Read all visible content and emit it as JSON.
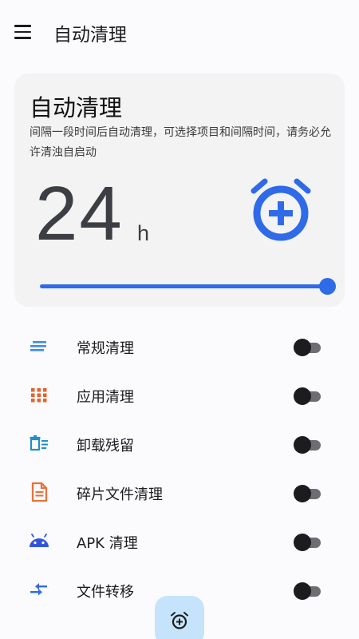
{
  "appbar": {
    "title": "自动清理",
    "menu_icon": "menu-icon"
  },
  "card": {
    "title": "自动清理",
    "description": "间隔一段时间后自动清理，可选择项目和间隔时间，请务必允许清浊自启动",
    "hours_value": "24",
    "hours_unit": "h",
    "alarm_icon": "alarm-add-icon",
    "slider_fraction": 1.0,
    "accent_color": "#2f6ae8"
  },
  "items": [
    {
      "label": "常规清理",
      "icon": "lines-icon",
      "color": "#3d8ee4",
      "enabled": false
    },
    {
      "label": "应用清理",
      "icon": "grid-icon",
      "color": "#e8602a",
      "enabled": false
    },
    {
      "label": "卸载残留",
      "icon": "trash-list-icon",
      "color": "#1f8fc9",
      "enabled": false
    },
    {
      "label": "碎片文件清理",
      "icon": "document-icon",
      "color": "#e8723a",
      "enabled": false
    },
    {
      "label": "APK 清理",
      "icon": "android-icon",
      "color": "#3355dd",
      "enabled": false
    },
    {
      "label": "文件转移",
      "icon": "transfer-icon",
      "color": "#2f6ae8",
      "enabled": false
    }
  ],
  "fab": {
    "icon": "alarm-add-icon",
    "color": "#c5e4fb"
  }
}
